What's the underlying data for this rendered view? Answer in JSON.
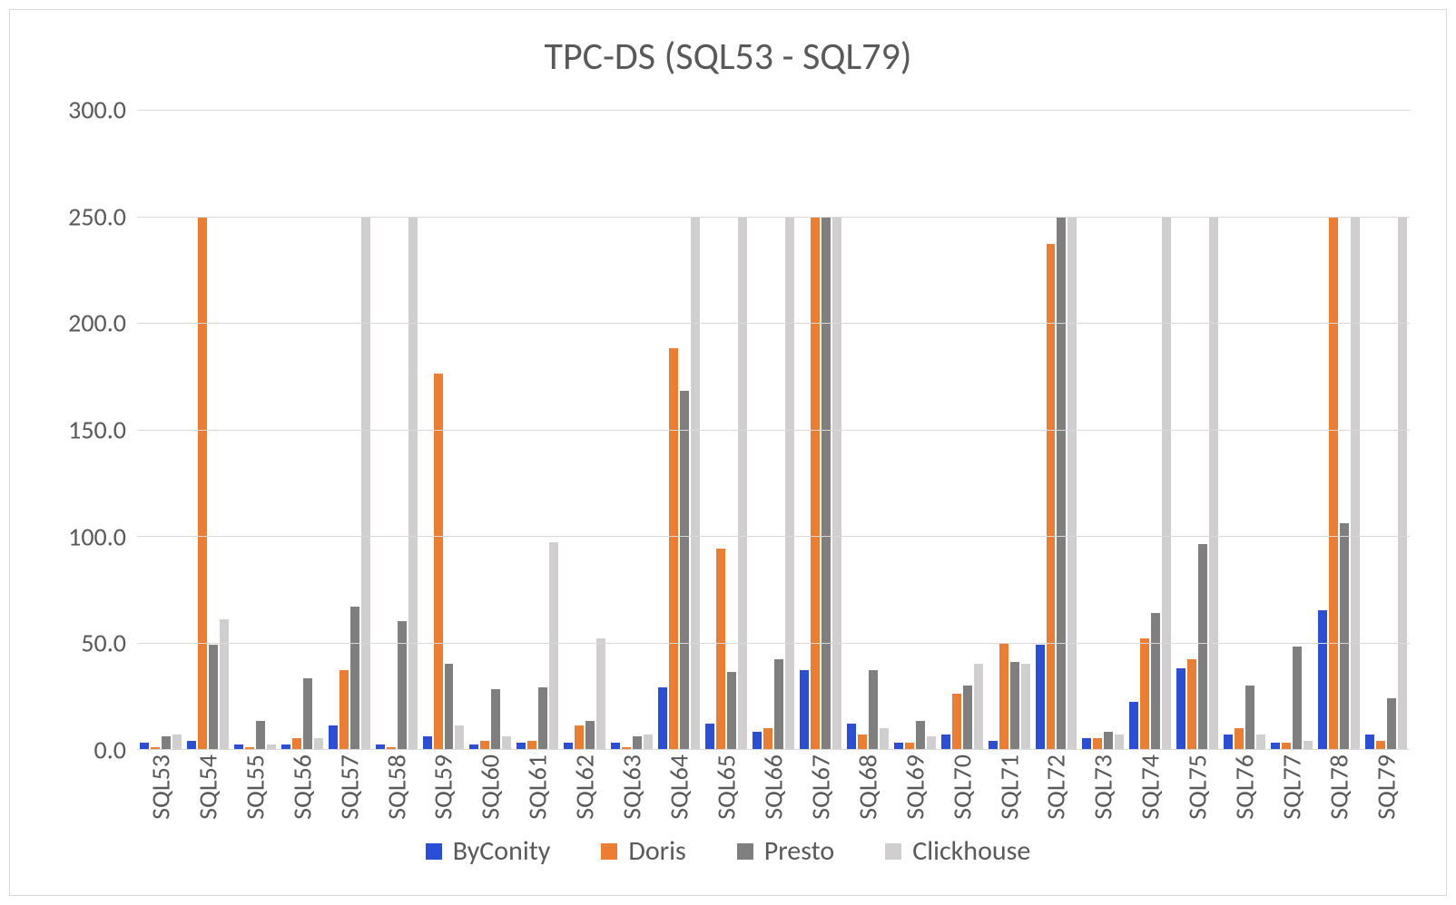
{
  "chart_data": {
    "type": "bar",
    "title": "TPC-DS  (SQL53 - SQL79)",
    "xlabel": "",
    "ylabel": "",
    "ylim": [
      0,
      300
    ],
    "yticks": [
      0.0,
      50.0,
      100.0,
      150.0,
      200.0,
      250.0,
      300.0
    ],
    "ytick_labels": [
      "0.0",
      "50.0",
      "100.0",
      "150.0",
      "200.0",
      "250.0",
      "300.0"
    ],
    "categories": [
      "SQL53",
      "SQL54",
      "SQL55",
      "SQL56",
      "SQL57",
      "SQL58",
      "SQL59",
      "SQL60",
      "SQL61",
      "SQL62",
      "SQL63",
      "SQL64",
      "SQL65",
      "SQL66",
      "SQL67",
      "SQL68",
      "SQL69",
      "SQL70",
      "SQL71",
      "SQL72",
      "SQL73",
      "SQL74",
      "SQL75",
      "SQL76",
      "SQL77",
      "SQL78",
      "SQL79"
    ],
    "series": [
      {
        "name": "ByConity",
        "color": "#2b4ed6",
        "values": [
          3,
          4,
          2,
          2,
          11,
          2,
          6,
          2,
          3,
          3,
          3,
          29,
          12,
          8,
          37,
          12,
          3,
          7,
          4,
          49,
          5,
          22,
          38,
          7,
          3,
          65,
          7
        ]
      },
      {
        "name": "Doris",
        "color": "#ed7d31",
        "values": [
          1,
          250,
          1,
          5,
          37,
          1,
          176,
          4,
          4,
          11,
          1,
          188,
          94,
          10,
          250,
          7,
          3,
          26,
          50,
          237,
          5,
          52,
          42,
          10,
          3,
          250,
          4
        ]
      },
      {
        "name": "Presto",
        "color": "#7f7f7f",
        "values": [
          6,
          49,
          13,
          33,
          67,
          60,
          40,
          28,
          29,
          13,
          6,
          168,
          36,
          42,
          250,
          37,
          13,
          30,
          41,
          250,
          8,
          64,
          96,
          30,
          48,
          106,
          24
        ]
      },
      {
        "name": "Clickhouse",
        "color": "#d0cece",
        "values": [
          7,
          61,
          2,
          5,
          250,
          250,
          11,
          6,
          97,
          52,
          7,
          250,
          250,
          250,
          250,
          10,
          6,
          40,
          40,
          250,
          7,
          250,
          250,
          7,
          4,
          250,
          250
        ]
      }
    ],
    "legend_position": "bottom"
  }
}
